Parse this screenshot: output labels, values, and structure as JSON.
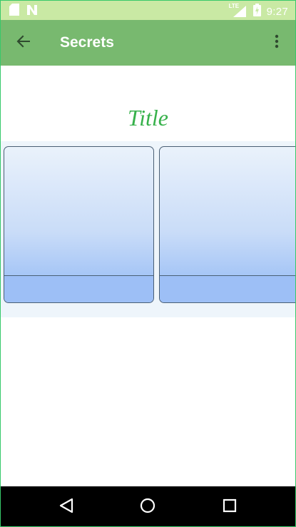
{
  "status_bar": {
    "time": "9:27",
    "network_label": "LTE",
    "icons": [
      "sd-card-icon",
      "n-notification-icon",
      "lte-signal-icon",
      "battery-icon"
    ]
  },
  "app_bar": {
    "title": "Secrets",
    "back_icon": "arrow-back-icon",
    "overflow_icon": "more-vert-icon"
  },
  "content": {
    "title": "Title",
    "cards": [
      {
        "label": ""
      },
      {
        "label": ""
      }
    ]
  },
  "nav_bar": {
    "icons": [
      "nav-back-icon",
      "nav-home-icon",
      "nav-recents-icon"
    ]
  },
  "colors": {
    "status_bar": "#c9e9a4",
    "app_bar": "#78b96f",
    "title_green": "#37b14b",
    "card_gradient_top": "#eaf2fb",
    "card_gradient_bottom": "#9bbdf4",
    "nav_bar": "#000000"
  }
}
